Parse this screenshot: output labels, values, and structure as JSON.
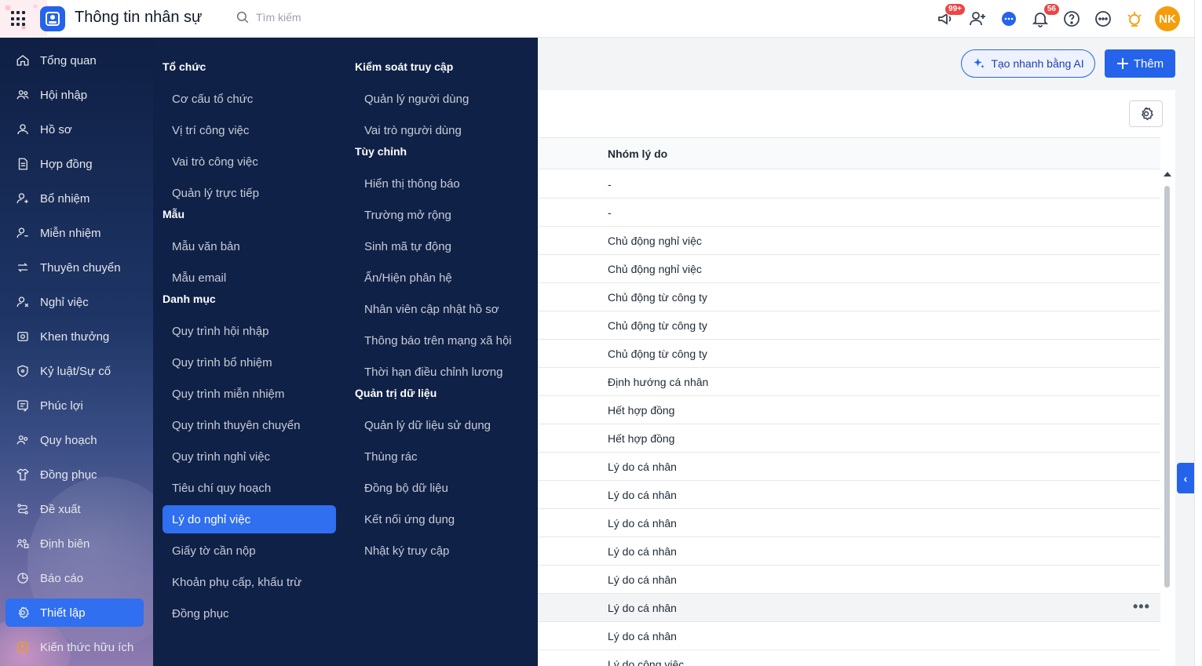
{
  "header": {
    "title": "Thông tin nhân sự",
    "search_placeholder": "Tìm kiếm",
    "badges": {
      "announcements": "99+",
      "notifications": "56"
    },
    "avatar_initials": "NK",
    "accent_color": "#2563eb"
  },
  "sidebar": {
    "items": [
      {
        "label": "Tổng quan",
        "icon": "home-icon"
      },
      {
        "label": "Hội nhập",
        "icon": "users-icon"
      },
      {
        "label": "Hồ sơ",
        "icon": "user-icon"
      },
      {
        "label": "Hợp đồng",
        "icon": "document-icon"
      },
      {
        "label": "Bổ nhiệm",
        "icon": "user-plus-icon"
      },
      {
        "label": "Miễn nhiệm",
        "icon": "user-minus-icon"
      },
      {
        "label": "Thuyên chuyển",
        "icon": "transfer-icon"
      },
      {
        "label": "Nghỉ việc",
        "icon": "user-x-icon"
      },
      {
        "label": "Khen thưởng",
        "icon": "award-icon"
      },
      {
        "label": "Kỷ luật/Sự cố",
        "icon": "shield-icon"
      },
      {
        "label": "Phúc lợi",
        "icon": "benefit-icon"
      },
      {
        "label": "Quy hoạch",
        "icon": "planning-icon"
      },
      {
        "label": "Đồng phục",
        "icon": "shirt-icon"
      },
      {
        "label": "Đề xuất",
        "icon": "proposal-icon"
      },
      {
        "label": "Định biên",
        "icon": "headcount-icon"
      },
      {
        "label": "Báo cáo",
        "icon": "chart-icon"
      },
      {
        "label": "Thiết lập",
        "icon": "gear-icon"
      },
      {
        "label": "Kiến thức hữu ích",
        "icon": "lightbulb-icon"
      }
    ],
    "active_index": 16
  },
  "mega_menu": {
    "col1": {
      "groups": [
        {
          "title": "Tổ chức",
          "items": [
            "Cơ cấu tổ chức",
            "Vị trí công việc",
            "Vai trò công việc",
            "Quản lý trực tiếp"
          ]
        },
        {
          "title": "Mẫu",
          "items": [
            "Mẫu văn bản",
            "Mẫu email"
          ]
        },
        {
          "title": "Danh mục",
          "items": [
            "Quy trình hội nhập",
            "Quy trình bổ nhiệm",
            "Quy trình miễn nhiệm",
            "Quy trình thuyên chuyển",
            "Quy trình nghỉ việc",
            "Tiêu chí quy hoạch",
            "Lý do nghỉ việc",
            "Giấy tờ cần nộp",
            "Khoản phụ cấp, khấu trừ",
            "Đồng phục"
          ]
        }
      ]
    },
    "col2": {
      "groups": [
        {
          "title": "Kiểm soát truy cập",
          "items": [
            "Quản lý người dùng",
            "Vai trò người dùng"
          ]
        },
        {
          "title": "Tùy chỉnh",
          "items": [
            "Hiển thị thông báo",
            "Trường mở rộng",
            "Sinh mã tự động",
            "Ẩn/Hiện phân hệ",
            "Nhân viên cập nhật hồ sơ",
            "Thông báo trên mạng xã hội",
            "Thời hạn điều chỉnh lương"
          ]
        },
        {
          "title": "Quản trị dữ liệu",
          "items": [
            "Quản lý dữ liệu sử dụng",
            "Thùng rác",
            "Đồng bộ dữ liệu",
            "Kết nối ứng dụng",
            "Nhật ký truy cập"
          ]
        }
      ]
    },
    "active_item": "Lý do nghỉ việc"
  },
  "toolbar": {
    "ai_button": "Tạo nhanh bằng AI",
    "add_button": "Thêm"
  },
  "table": {
    "column_header": "Nhóm lý do",
    "rows": [
      "-",
      "-",
      "Chủ động nghỉ việc",
      "Chủ động nghỉ việc",
      "Chủ động từ công ty",
      "Chủ động từ công ty",
      "Chủ động từ công ty",
      "Định hướng cá nhân",
      "Hết hợp đồng",
      "Hết hợp đồng",
      "Lý do cá nhân",
      "Lý do cá nhân",
      "Lý do cá nhân",
      "Lý do cá nhân",
      "Lý do cá nhân",
      "Lý do cá nhân",
      "Lý do cá nhân",
      "Lý do công việc"
    ],
    "hover_row": 15,
    "more_icon": "more-dots-icon"
  }
}
